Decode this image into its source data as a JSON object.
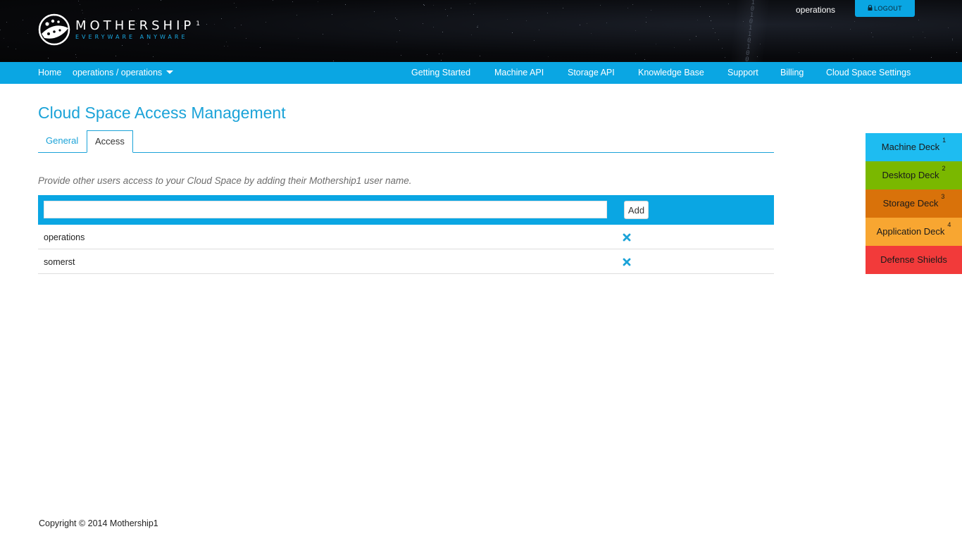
{
  "header": {
    "logo": {
      "name": "MOTHERSHIP",
      "superscript": "1",
      "tagline": "EVERYWARE ANYWARE"
    },
    "username": "operations",
    "logout_label": "LOGOUT",
    "binary_text": "1\n0\n1\n0\n1\n1\n0\n1\n0\n0\n1"
  },
  "nav": {
    "left": [
      {
        "label": "Home"
      },
      {
        "label": "operations / operations",
        "has_dropdown": true
      }
    ],
    "right": [
      {
        "label": "Getting Started"
      },
      {
        "label": "Machine API"
      },
      {
        "label": "Storage API"
      },
      {
        "label": "Knowledge Base"
      },
      {
        "label": "Support"
      },
      {
        "label": "Billing"
      },
      {
        "label": "Cloud Space Settings"
      }
    ]
  },
  "main": {
    "title": "Cloud Space Access Management",
    "tabs": [
      {
        "label": "General",
        "active": false
      },
      {
        "label": "Access",
        "active": true
      }
    ],
    "hint": "Provide other users access to your Cloud Space by adding their Mothership1 user name.",
    "add_form": {
      "value": "",
      "placeholder": "",
      "button_label": "Add"
    },
    "users": [
      {
        "name": "operations"
      },
      {
        "name": "somerst"
      }
    ]
  },
  "decks": [
    {
      "label": "Machine Deck",
      "sup": "1",
      "color": "#1ebcf1"
    },
    {
      "label": "Desktop Deck",
      "sup": "2",
      "color": "#7ab800"
    },
    {
      "label": "Storage Deck",
      "sup": "3",
      "color": "#d9720a"
    },
    {
      "label": "Application Deck",
      "sup": "4",
      "color": "#f8a631"
    },
    {
      "label": "Defense Shields",
      "sup": "",
      "color": "#f23a3a"
    }
  ],
  "colors": {
    "accent": "#0aa6e3",
    "title": "#1ba3d8",
    "header_bg": "#08090c"
  },
  "icons": {
    "logout": "lock-icon",
    "remove": "close-icon",
    "dropdown": "caret-down-icon"
  },
  "footer": {
    "text": "Copyright © 2014 Mothership1"
  }
}
